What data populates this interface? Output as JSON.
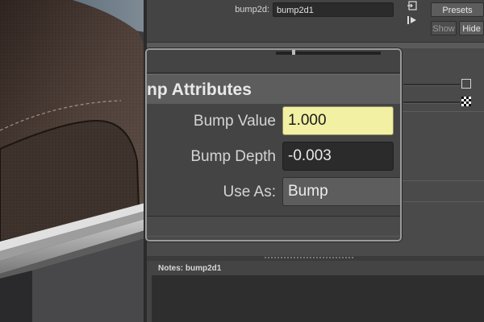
{
  "node": {
    "label": "bump2d:",
    "value": "bump2d1"
  },
  "buttons": {
    "presets": "Presets",
    "show": "Show",
    "hide": "Hide"
  },
  "icons": {
    "focus": "focus-node-icon",
    "output": "output-connections-icon",
    "connect": "connect-input-icon",
    "checker": "checker-texture-icon"
  },
  "section": {
    "title": "np Attributes"
  },
  "attributes": [
    {
      "label": "Bump Value",
      "value": "1.000"
    },
    {
      "label": "Bump Depth",
      "value": "-0.003"
    },
    {
      "label": "Use As:",
      "value": "Bump"
    }
  ],
  "notes": {
    "label": "Notes:  bump2d1"
  },
  "colors": {
    "highlight_field": "#f2f0a2",
    "panel_bg": "#444444",
    "dark_field": "#2b2b2b",
    "leather": "#4a3c35"
  }
}
